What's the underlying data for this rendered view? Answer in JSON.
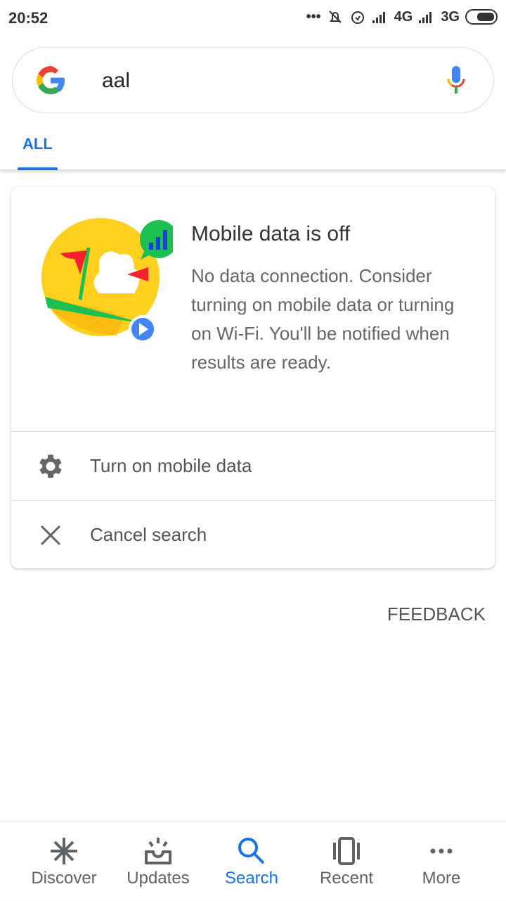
{
  "status_bar": {
    "time": "20:52",
    "network1": "4G",
    "network2": "3G"
  },
  "search": {
    "query": "aal"
  },
  "tabs": [
    {
      "label": "ALL",
      "active": true
    }
  ],
  "card": {
    "title": "Mobile data is off",
    "body": "No data connection. Consider turning on mobile data or turning on Wi-Fi. You'll be notified when results are ready.",
    "actions": [
      {
        "label": "Turn on mobile data",
        "icon": "gear-icon"
      },
      {
        "label": "Cancel search",
        "icon": "close-icon"
      }
    ]
  },
  "feedback": "FEEDBACK",
  "bottom_nav": [
    {
      "label": "Discover",
      "icon": "asterisk-icon"
    },
    {
      "label": "Updates",
      "icon": "inbox-icon"
    },
    {
      "label": "Search",
      "icon": "search-icon",
      "active": true
    },
    {
      "label": "Recent",
      "icon": "cards-icon"
    },
    {
      "label": "More",
      "icon": "more-icon"
    }
  ],
  "colors": {
    "accent": "#1a73e8",
    "text": "#333333",
    "secondary": "#5f6368"
  }
}
